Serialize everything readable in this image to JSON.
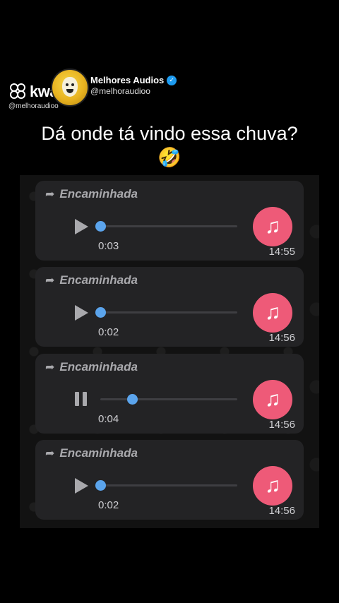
{
  "watermark": {
    "brand": "kwai",
    "handle": "@melhoraudioo"
  },
  "channel": {
    "name": "Melhores Audios",
    "handle": "@melhoraudioo"
  },
  "caption": "Dá onde tá vindo essa chuva? 🤣",
  "messages": [
    {
      "label": "Encaminhada",
      "duration": "0:03",
      "time": "14:55",
      "state": "play",
      "progress": 0.0
    },
    {
      "label": "Encaminhada",
      "duration": "0:02",
      "time": "14:56",
      "state": "play",
      "progress": 0.0
    },
    {
      "label": "Encaminhada",
      "duration": "0:04",
      "time": "14:56",
      "state": "pause",
      "progress": 0.23
    },
    {
      "label": "Encaminhada",
      "duration": "0:02",
      "time": "14:56",
      "state": "play",
      "progress": 0.0
    }
  ],
  "icons": {
    "forward": "forward-arrow-icon",
    "music": "music-note-icon",
    "verified": "verified-badge-icon"
  },
  "colors": {
    "accent": "#5ba4ec",
    "music": "#ee5a78",
    "bubble": "#232325"
  }
}
